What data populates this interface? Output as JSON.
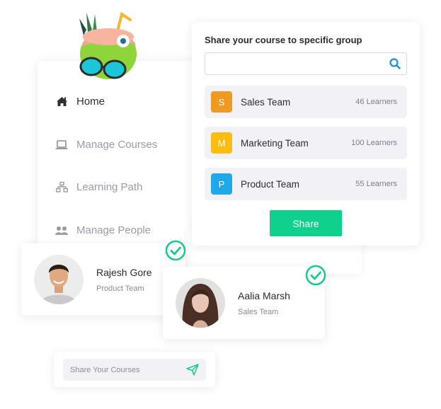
{
  "sidebar": {
    "items": [
      {
        "label": "Home",
        "icon": "home-icon",
        "active": true
      },
      {
        "label": "Manage Courses",
        "icon": "laptop-icon",
        "active": false
      },
      {
        "label": "Learning Path",
        "icon": "sitemap-icon",
        "active": false
      },
      {
        "label": "Manage People",
        "icon": "users-icon",
        "active": false
      }
    ]
  },
  "share_panel": {
    "title": "Share your course to specific group",
    "search": {
      "value": "",
      "placeholder": ""
    },
    "groups": [
      {
        "initial": "S",
        "name": "Sales Team",
        "count": "46 Learners",
        "color": "#ee9a22"
      },
      {
        "initial": "M",
        "name": "Marketing Team",
        "count": "100 Learners",
        "color": "#fdbd10"
      },
      {
        "initial": "P",
        "name": "Product Team",
        "count": "55 Learners",
        "color": "#1fa9ea"
      }
    ],
    "share_label": "Share"
  },
  "people": [
    {
      "name": "Rajesh Gore",
      "team": "Product Team",
      "selected": true
    },
    {
      "name": "Aalia Marsh",
      "team": "Sales Team",
      "selected": true
    }
  ],
  "share_courses": {
    "placeholder": "Share Your Courses"
  },
  "colors": {
    "accent": "#0fd08d",
    "search_icon": "#1a8fd6",
    "muted_text": "#9b9ba8"
  }
}
